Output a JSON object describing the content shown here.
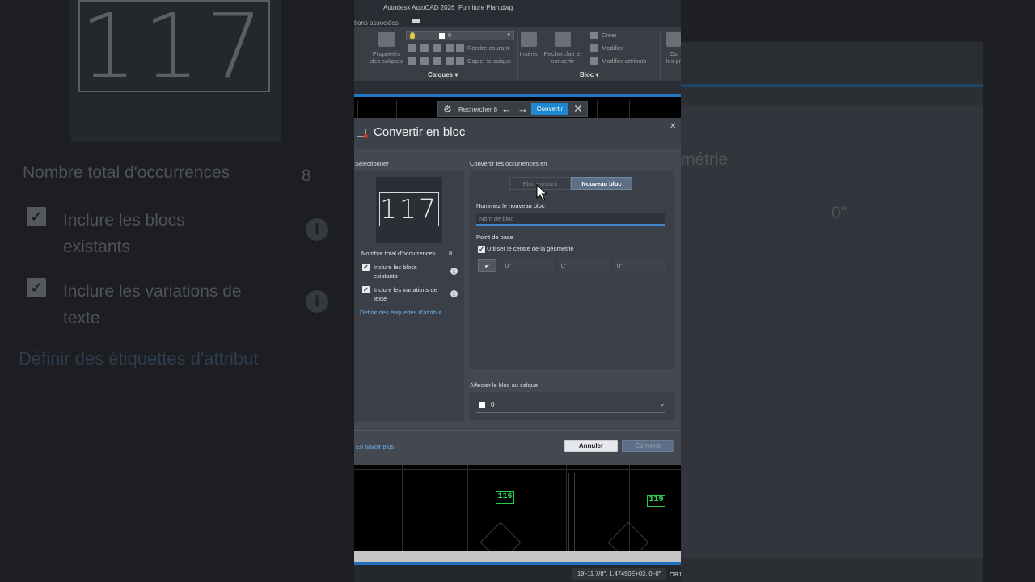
{
  "titlebar": {
    "app": "Autodesk AutoCAD 2026",
    "file": "Furniture Plan.dwg",
    "tab_fragment": "tions associées"
  },
  "ribbon": {
    "layer_props": "Propriétés\ndes calques",
    "layer_value": "0",
    "rendre_courant": "Rendre courant",
    "copier_calque": "Copier le calque",
    "inserer": "Insérer",
    "rechercher_convertir": "Rechercher et\nconvertir",
    "creer": "Créer",
    "modifier": "Modifier",
    "modifier_attributs": "Modifier attributs",
    "cut_label": "Co\nles pr",
    "group_calques": "Calques ▾",
    "group_bloc": "Bloc ▾"
  },
  "findbar": {
    "label": "Rechercher 8",
    "convert": "Convertir"
  },
  "dialog": {
    "title": "Convertir en bloc",
    "select_label": "Sélectionner",
    "preview_text": "117",
    "total_label": "Nombre total d'occurrences",
    "total_value": "8",
    "include_blocks": "Inclure les blocs\nexistants",
    "include_variations": "Inclure les variations de\ntexte",
    "define_attr_link": "Définir des étiquettes d'attribut",
    "convert_occ_label": "Convertir les occurrences en",
    "seg_existing": "Bloc existant",
    "seg_new": "Nouveau bloc",
    "name_label": "Nommez le nouveau bloc",
    "name_placeholder": "Nom de bloc",
    "base_point_label": "Point de base",
    "use_center": "Utiliser le centre de la géométrie",
    "coord_x": "0\"",
    "coord_y": "0\"",
    "coord_z": "0\"",
    "assign_layer_label": "Affecter le bloc au calque",
    "layer_value": "0",
    "learn_more": "En savoir plus",
    "cancel": "Annuler",
    "convert": "Convertir"
  },
  "canvas": {
    "tag_a": "116",
    "tag_b": "119"
  },
  "statusbar": {
    "coords": "19'-11 7/8\", 1.47490E+03, 0'-0\"",
    "obj": "OBJ"
  },
  "background": {
    "thumb_text": "117",
    "total_label": "Nombre total d'occurrences",
    "total_value": "8",
    "include_blocks": "Inclure les blocs\nexistants",
    "include_variations": "Inclure les variations de\ntexte",
    "define_attr_link": "Définir des étiquettes d'attribut",
    "right_fragment": "métrie",
    "right_zero": "0\""
  },
  "colors": {
    "accent": "#1e88d1",
    "tag_green": "#27d04a",
    "dialog_bg": "#444851"
  }
}
